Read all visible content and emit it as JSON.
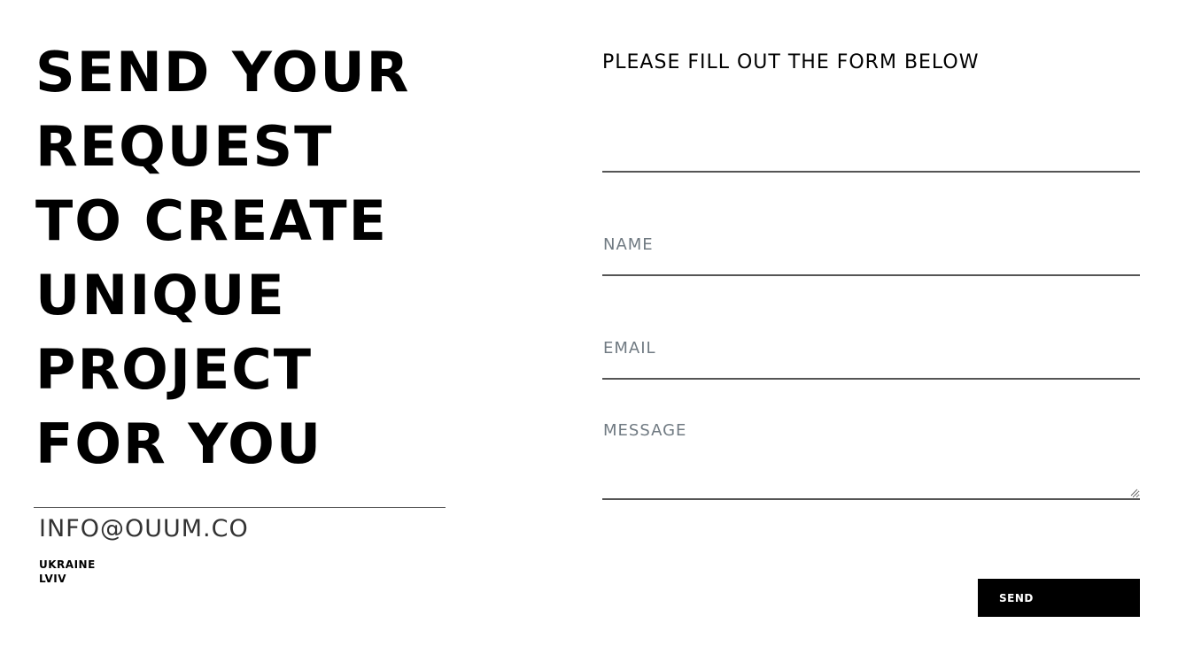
{
  "hero": {
    "lines": [
      "SEND YOUR",
      "REQUEST",
      "TO CREATE",
      "UNIQUE",
      "PROJECT",
      "FOR YOU"
    ]
  },
  "contact": {
    "email": "INFO@OUUM.CO",
    "country": "UKRAINE",
    "city": "LVIV"
  },
  "form": {
    "title": "PLEASE FILL OUT THE FORM BELOW",
    "blank_placeholder": "",
    "name_placeholder": "NAME",
    "email_placeholder": "EMAIL",
    "message_placeholder": "MESSAGE",
    "submit_label": "SEND"
  },
  "colors": {
    "text": "#000000",
    "placeholder": "#707a82",
    "divider": "#555555",
    "button_bg": "#000000",
    "button_text": "#ffffff"
  }
}
